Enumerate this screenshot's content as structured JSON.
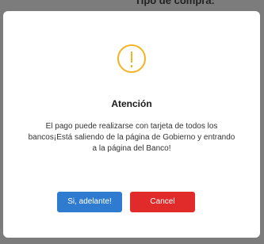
{
  "backdrop": {
    "partial_text": "Tipo de compra:"
  },
  "dialog": {
    "icon": "warning-icon",
    "icon_symbol": "!",
    "accent_color": "#f5b321",
    "title": "Atención",
    "message": "El pago puede realizarse con tarjeta de todos los bancos¡Está saliendo de la página de Gobierno y entrando a la página del Banco!",
    "confirm_label": "Si, adelante!",
    "confirm_color": "#2e7bd0",
    "cancel_label": "Cancel",
    "cancel_color": "#e12b2b"
  }
}
